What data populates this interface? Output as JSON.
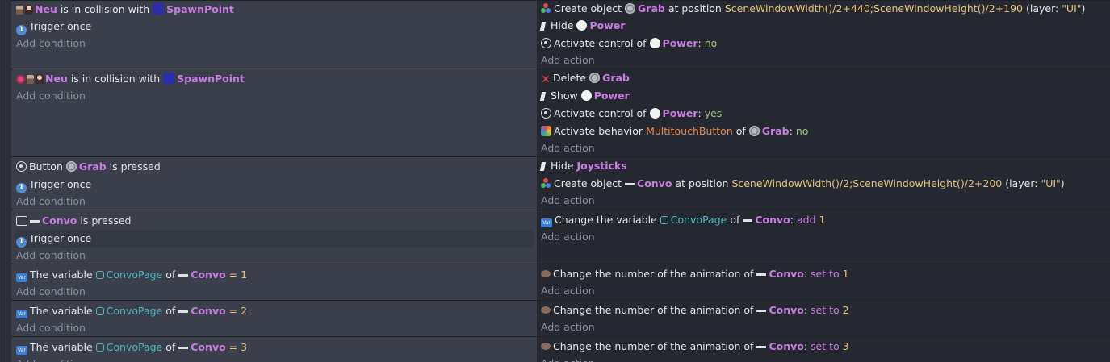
{
  "events": [
    {
      "conditions": [
        {
          "obj": "Neu",
          "text": "is in collision with",
          "target": "SpawnPoint"
        },
        {
          "text": "Trigger once"
        },
        {
          "add": "Add condition"
        }
      ],
      "actions": [
        {
          "pre": "Create object",
          "obj": "Grab",
          "mid": "at position",
          "val": "SceneWindowWidth()/2+440;SceneWindowHeight()/2+190",
          "layer_pre": "(layer:",
          "layer": "\"UI\"",
          "layer_post": ")"
        },
        {
          "pre": "Hide",
          "obj": "Power"
        },
        {
          "pre": "Activate control of",
          "obj": "Power",
          "sep": ":",
          "val": "no"
        },
        {
          "add": "Add action"
        }
      ]
    },
    {
      "conditions": [
        {
          "obj": "Neu",
          "text": "is in collision with",
          "target": "SpawnPoint"
        },
        {
          "add": "Add condition"
        }
      ],
      "actions": [
        {
          "pre": "Delete",
          "obj": "Grab"
        },
        {
          "pre": "Show",
          "obj": "Power"
        },
        {
          "pre": "Activate control of",
          "obj": "Power",
          "sep": ":",
          "val": "yes"
        },
        {
          "pre": "Activate behavior",
          "beh": "MultitouchButton",
          "mid": "of",
          "obj": "Grab",
          "sep": ":",
          "val": "no"
        },
        {
          "add": "Add action"
        }
      ]
    },
    {
      "conditions": [
        {
          "pre": "Button",
          "obj": "Grab",
          "text": "is pressed"
        },
        {
          "text": "Trigger once"
        },
        {
          "add": "Add condition"
        }
      ],
      "actions": [
        {
          "pre": "Hide",
          "obj": "Joysticks"
        },
        {
          "pre": "Create object",
          "obj": "Convo",
          "mid": "at position",
          "val": "SceneWindowWidth()/2;SceneWindowHeight()/2+200",
          "layer_pre": "(layer:",
          "layer": "\"UI\"",
          "layer_post": ")"
        },
        {
          "add": "Add action"
        }
      ]
    },
    {
      "conditions": [
        {
          "obj": "Convo",
          "text": "is pressed"
        },
        {
          "text": "Trigger once"
        },
        {
          "add": "Add condition"
        }
      ],
      "actions": [
        {
          "pre": "Change the variable",
          "var": "ConvoPage",
          "mid": "of",
          "obj": "Convo",
          "sep": ":",
          "op": "add",
          "num": "1"
        },
        {
          "add": "Add action"
        }
      ]
    },
    {
      "conditions": [
        {
          "pre": "The variable",
          "var": "ConvoPage",
          "mid": "of",
          "obj": "Convo",
          "op": "=",
          "num": "1"
        },
        {
          "add": "Add condition"
        }
      ],
      "actions": [
        {
          "pre": "Change the number of the animation of",
          "obj": "Convo",
          "sep": ":",
          "op": "set to",
          "num": "1"
        },
        {
          "add": "Add action"
        }
      ]
    },
    {
      "conditions": [
        {
          "pre": "The variable",
          "var": "ConvoPage",
          "mid": "of",
          "obj": "Convo",
          "op": "=",
          "num": "2"
        },
        {
          "add": "Add condition"
        }
      ],
      "actions": [
        {
          "pre": "Change the number of the animation of",
          "obj": "Convo",
          "sep": ":",
          "op": "set to",
          "num": "2"
        },
        {
          "add": "Add action"
        }
      ]
    },
    {
      "conditions": [
        {
          "pre": "The variable",
          "var": "ConvoPage",
          "mid": "of",
          "obj": "Convo",
          "op": "=",
          "num": "3"
        },
        {
          "add": "Add condition"
        }
      ],
      "actions": [
        {
          "pre": "Change the number of the animation of",
          "obj": "Convo",
          "sep": ":",
          "op": "set to",
          "num": "3"
        },
        {
          "add": "Add action"
        }
      ]
    }
  ]
}
